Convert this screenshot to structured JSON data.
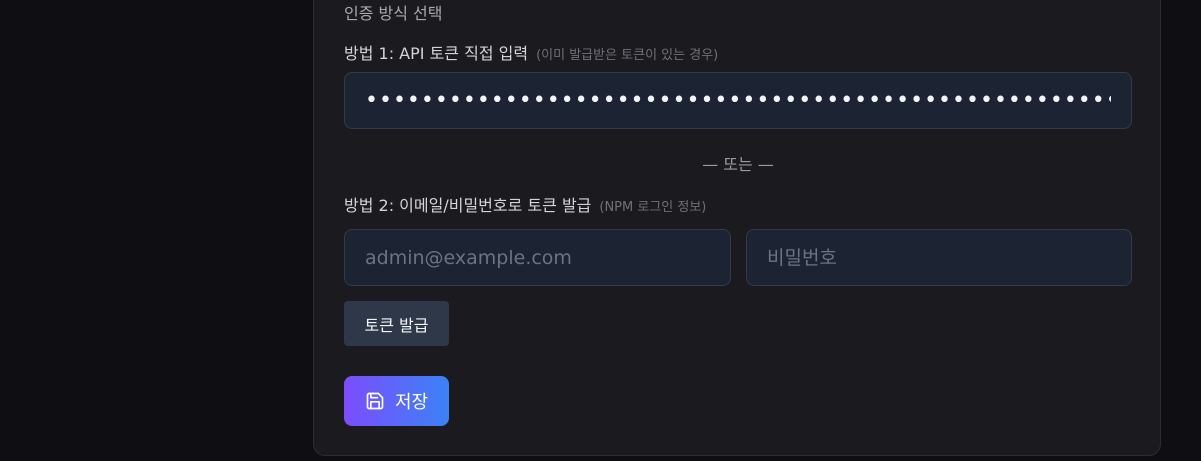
{
  "auth": {
    "section_title": "인증 방식 선택",
    "method1": {
      "label": "방법 1: API 토큰 직접 입력",
      "hint": "(이미 발급받은 토큰이 있는 경우)",
      "token_value": "••••••••••••••••••••••••••••••••••••••••••••••••••••••••••••••••••••••••••"
    },
    "divider_text": "— 또는 —",
    "method2": {
      "label": "방법 2: 이메일/비밀번호로 토큰 발급",
      "hint": "(NPM 로그인 정보)",
      "email_placeholder": "admin@example.com",
      "password_placeholder": "비밀번호",
      "issue_button": "토큰 발급"
    },
    "save_button": "저장",
    "save_icon": "floppy-disk-icon"
  }
}
